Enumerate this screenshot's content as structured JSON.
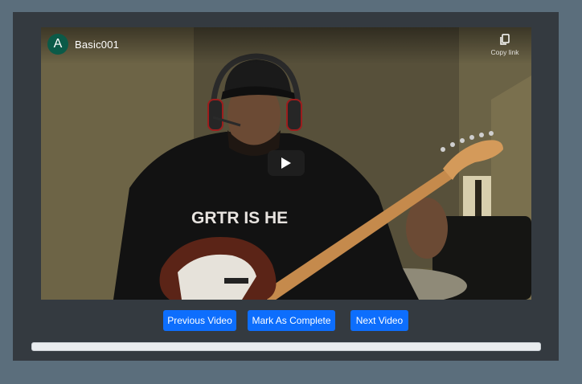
{
  "video": {
    "channel_initial": "A",
    "channel_name": "Basic001",
    "copy_link_label": "Copy link",
    "hoodie_text": "GRTR IS HE",
    "play_icon": "play-icon",
    "copy_icon": "copy-icon"
  },
  "controls": {
    "previous_label": "Previous Video",
    "complete_label": "Mark As Complete",
    "next_label": "Next Video"
  },
  "progress": {
    "value": 0
  },
  "colors": {
    "page_background": "#5b6e7c",
    "panel_background": "#343a40",
    "button_primary": "#0d6efd",
    "avatar": "#0b5a48"
  }
}
